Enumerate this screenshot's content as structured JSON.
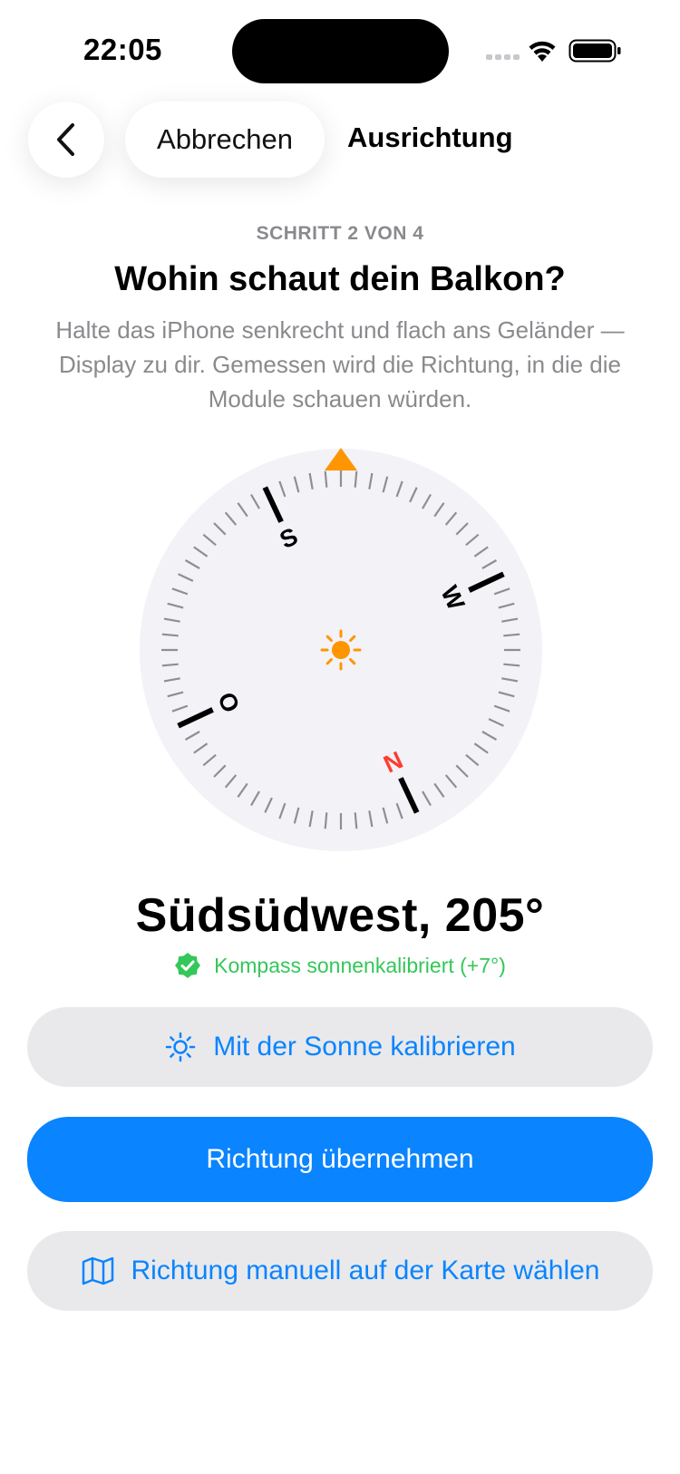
{
  "status_bar": {
    "time": "22:05"
  },
  "nav": {
    "cancel_label": "Abbrechen",
    "title": "Ausrichtung"
  },
  "step": {
    "label": "SCHRITT 2 VON 4"
  },
  "header": {
    "title": "Wohin schaut dein Balkon?",
    "instruction": "Halte das iPhone senkrecht und flach ans Geländer — Display zu dir. Gemessen wird die Richtung, in die die Module schauen würden."
  },
  "compass": {
    "heading_degrees": 205,
    "cardinals": {
      "north": "N",
      "east": "O",
      "south": "S",
      "west": "W"
    },
    "colors": {
      "north": "#ff3b30",
      "marker": "#ff9500",
      "sun": "#ff9500"
    }
  },
  "readout": {
    "heading_text": "Südsüdwest, 205°",
    "calibration_text": "Kompass sonnenkalibriert (+7°)"
  },
  "buttons": {
    "sun_calibrate": "Mit der Sonne kalibrieren",
    "accept": "Richtung übernehmen",
    "manual_map": "Richtung manuell auf der Karte wählen"
  },
  "colors": {
    "accent": "#0a84ff",
    "success": "#34c759",
    "button_bg": "#e9e9eb"
  }
}
